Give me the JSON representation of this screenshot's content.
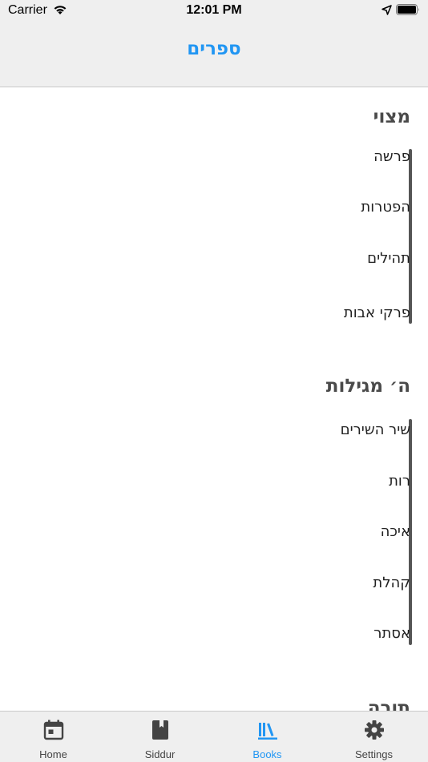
{
  "status": {
    "carrier": "Carrier",
    "time": "12:01 PM"
  },
  "nav": {
    "title": "ספרים"
  },
  "sections": [
    {
      "title": "מצוי",
      "items": [
        "פרשה",
        "הפטרות",
        "תהילים",
        "פרקי אבות"
      ]
    },
    {
      "title": "ה׳ מגילות",
      "items": [
        "שיר השירים",
        "רות",
        "איכה",
        "קהלת",
        "אסתר"
      ]
    },
    {
      "title": "תורה"
    }
  ],
  "tabs": [
    {
      "label": "Home",
      "icon": "calendar-icon"
    },
    {
      "label": "Siddur",
      "icon": "book-icon"
    },
    {
      "label": "Books",
      "icon": "library-icon",
      "active": true
    },
    {
      "label": "Settings",
      "icon": "gear-icon"
    }
  ],
  "colors": {
    "accent": "#2196f3",
    "bar": "#555555"
  }
}
